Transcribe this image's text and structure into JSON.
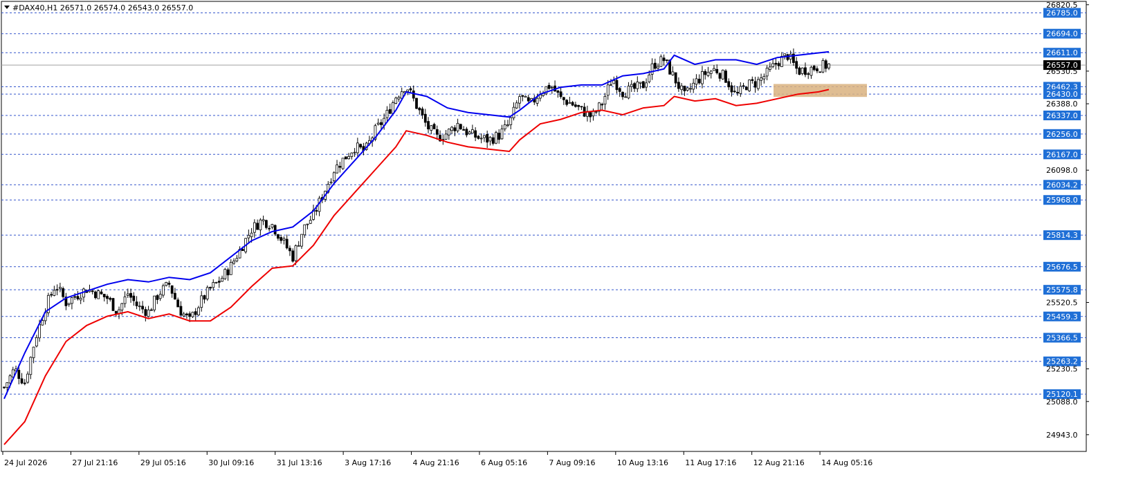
{
  "header": {
    "symbol_line": "#DAX40,H1  26571.0 26574.0 26543.0 26557.0"
  },
  "colors": {
    "background": "#ffffff",
    "frame": "#000000",
    "level_line": "#3355cc",
    "level_tag_fill": "#1f6fd6",
    "price_tag_fill": "#000000",
    "upper_band": "#0000ee",
    "lower_band": "#ee0000",
    "zone_fill": "#d9b27f",
    "candle": "#000000"
  },
  "chart_data": {
    "type": "candlestick",
    "instrument": "#DAX40",
    "timeframe": "H1",
    "last_bar": {
      "open": 26571.0,
      "high": 26574.0,
      "low": 26543.0,
      "close": 26557.0
    },
    "current_price": "26557.0",
    "ylim": [
      24870,
      26835
    ],
    "grid": false,
    "y_ticks": [
      "26820.5",
      "26530.5",
      "26388.0",
      "26098.0",
      "25520.5",
      "25230.5",
      "25088.0",
      "24943.0"
    ],
    "x_ticks": [
      "24 Jul 2026",
      "27 Jul 21:16",
      "29 Jul 05:16",
      "30 Jul 09:16",
      "31 Jul 13:16",
      "3 Aug 17:16",
      "4 Aug 21:16",
      "6 Aug 05:16",
      "7 Aug 09:16",
      "10 Aug 13:16",
      "11 Aug 17:16",
      "12 Aug 21:16",
      "14 Aug 05:16"
    ],
    "levels": [
      "26785.0",
      "26694.0",
      "26611.0",
      "26462.3",
      "26430.0",
      "26337.0",
      "26256.0",
      "26167.0",
      "26034.2",
      "25968.0",
      "25814.3",
      "25676.5",
      "25575.8",
      "25459.3",
      "25366.5",
      "25263.2",
      "25120.1"
    ],
    "zone": {
      "from": 26430.0,
      "to": 26462.3
    },
    "close_path": [
      [
        0,
        25150
      ],
      [
        2,
        25230
      ],
      [
        4,
        25170
      ],
      [
        6,
        25360
      ],
      [
        8,
        25500
      ],
      [
        10,
        25600
      ],
      [
        12,
        25520
      ],
      [
        14,
        25550
      ],
      [
        16,
        25580
      ],
      [
        18,
        25560
      ],
      [
        20,
        25540
      ],
      [
        22,
        25480
      ],
      [
        24,
        25560
      ],
      [
        26,
        25500
      ],
      [
        28,
        25480
      ],
      [
        30,
        25560
      ],
      [
        32,
        25600
      ],
      [
        34,
        25490
      ],
      [
        36,
        25440
      ],
      [
        38,
        25520
      ],
      [
        40,
        25580
      ],
      [
        42,
        25620
      ],
      [
        44,
        25680
      ],
      [
        46,
        25760
      ],
      [
        48,
        25840
      ],
      [
        50,
        25880
      ],
      [
        52,
        25860
      ],
      [
        54,
        25790
      ],
      [
        56,
        25720
      ],
      [
        58,
        25840
      ],
      [
        60,
        25900
      ],
      [
        62,
        26000
      ],
      [
        64,
        26100
      ],
      [
        66,
        26150
      ],
      [
        68,
        26200
      ],
      [
        70,
        26180
      ],
      [
        72,
        26270
      ],
      [
        74,
        26330
      ],
      [
        76,
        26420
      ],
      [
        78,
        26470
      ],
      [
        80,
        26380
      ],
      [
        82,
        26290
      ],
      [
        84,
        26240
      ],
      [
        86,
        26260
      ],
      [
        88,
        26300
      ],
      [
        90,
        26260
      ],
      [
        92,
        26240
      ],
      [
        94,
        26230
      ],
      [
        96,
        26250
      ],
      [
        98,
        26300
      ],
      [
        100,
        26420
      ],
      [
        102,
        26380
      ],
      [
        104,
        26440
      ],
      [
        106,
        26470
      ],
      [
        108,
        26410
      ],
      [
        110,
        26390
      ],
      [
        112,
        26360
      ],
      [
        114,
        26330
      ],
      [
        116,
        26390
      ],
      [
        118,
        26500
      ],
      [
        120,
        26440
      ],
      [
        122,
        26450
      ],
      [
        124,
        26470
      ],
      [
        126,
        26560
      ],
      [
        128,
        26580
      ],
      [
        130,
        26500
      ],
      [
        132,
        26420
      ],
      [
        134,
        26480
      ],
      [
        136,
        26520
      ],
      [
        138,
        26540
      ],
      [
        140,
        26500
      ],
      [
        142,
        26420
      ],
      [
        144,
        26470
      ],
      [
        146,
        26480
      ],
      [
        148,
        26520
      ],
      [
        150,
        26570
      ],
      [
        152,
        26600
      ],
      [
        154,
        26530
      ],
      [
        156,
        26540
      ],
      [
        158,
        26550
      ],
      [
        160,
        26557
      ]
    ],
    "upper_band": [
      [
        0,
        25100
      ],
      [
        4,
        25300
      ],
      [
        8,
        25480
      ],
      [
        12,
        25540
      ],
      [
        16,
        25570
      ],
      [
        20,
        25600
      ],
      [
        24,
        25620
      ],
      [
        28,
        25610
      ],
      [
        32,
        25630
      ],
      [
        36,
        25620
      ],
      [
        40,
        25650
      ],
      [
        44,
        25720
      ],
      [
        48,
        25790
      ],
      [
        52,
        25830
      ],
      [
        56,
        25850
      ],
      [
        60,
        25920
      ],
      [
        64,
        26040
      ],
      [
        68,
        26140
      ],
      [
        72,
        26240
      ],
      [
        76,
        26360
      ],
      [
        78,
        26440
      ],
      [
        82,
        26420
      ],
      [
        86,
        26370
      ],
      [
        90,
        26350
      ],
      [
        94,
        26340
      ],
      [
        98,
        26330
      ],
      [
        100,
        26360
      ],
      [
        104,
        26430
      ],
      [
        108,
        26460
      ],
      [
        112,
        26470
      ],
      [
        116,
        26470
      ],
      [
        120,
        26510
      ],
      [
        124,
        26520
      ],
      [
        128,
        26540
      ],
      [
        130,
        26600
      ],
      [
        134,
        26560
      ],
      [
        138,
        26580
      ],
      [
        142,
        26580
      ],
      [
        146,
        26560
      ],
      [
        150,
        26590
      ],
      [
        154,
        26600
      ],
      [
        158,
        26610
      ],
      [
        160,
        26615
      ]
    ],
    "lower_band": [
      [
        0,
        24900
      ],
      [
        4,
        25000
      ],
      [
        8,
        25200
      ],
      [
        12,
        25350
      ],
      [
        16,
        25420
      ],
      [
        20,
        25460
      ],
      [
        24,
        25480
      ],
      [
        28,
        25450
      ],
      [
        32,
        25470
      ],
      [
        36,
        25440
      ],
      [
        40,
        25440
      ],
      [
        44,
        25500
      ],
      [
        48,
        25590
      ],
      [
        52,
        25670
      ],
      [
        56,
        25680
      ],
      [
        60,
        25770
      ],
      [
        64,
        25900
      ],
      [
        68,
        26000
      ],
      [
        72,
        26100
      ],
      [
        76,
        26200
      ],
      [
        78,
        26270
      ],
      [
        82,
        26250
      ],
      [
        86,
        26220
      ],
      [
        90,
        26200
      ],
      [
        94,
        26190
      ],
      [
        98,
        26180
      ],
      [
        100,
        26230
      ],
      [
        104,
        26300
      ],
      [
        108,
        26320
      ],
      [
        112,
        26350
      ],
      [
        116,
        26360
      ],
      [
        120,
        26340
      ],
      [
        124,
        26370
      ],
      [
        128,
        26380
      ],
      [
        130,
        26420
      ],
      [
        134,
        26400
      ],
      [
        138,
        26410
      ],
      [
        142,
        26380
      ],
      [
        146,
        26390
      ],
      [
        150,
        26410
      ],
      [
        154,
        26430
      ],
      [
        158,
        26440
      ],
      [
        160,
        26450
      ]
    ]
  }
}
